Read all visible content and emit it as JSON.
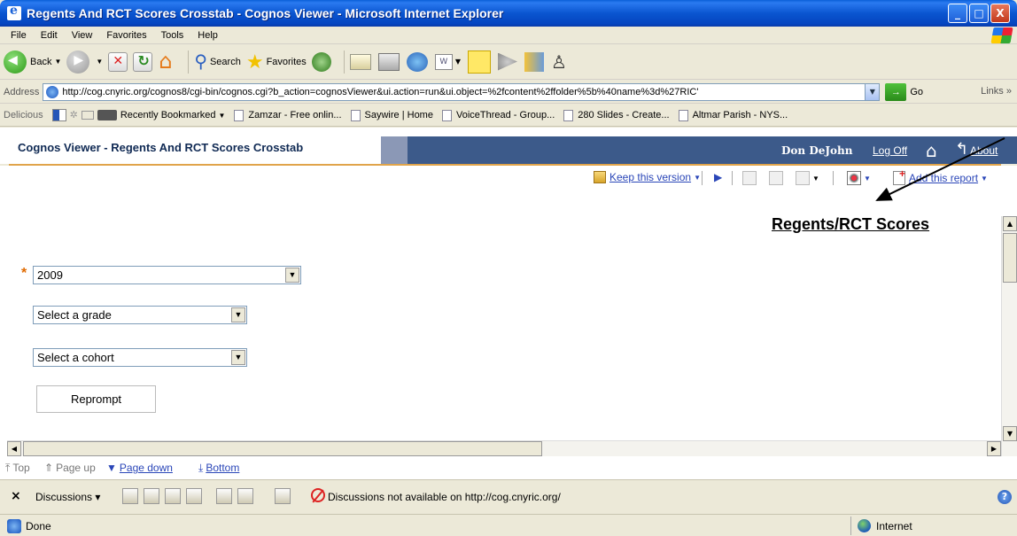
{
  "window": {
    "title": "Regents And RCT Scores Crosstab - Cognos Viewer - Microsoft Internet Explorer",
    "controls": {
      "minimize": "_",
      "maximize": "□",
      "close": "X"
    }
  },
  "menu": {
    "items": [
      "File",
      "Edit",
      "View",
      "Favorites",
      "Tools",
      "Help"
    ]
  },
  "toolbar": {
    "back": "Back",
    "search": "Search",
    "favorites": "Favorites",
    "word_label": "W"
  },
  "address": {
    "label": "Address",
    "url": "http://cog.cnyric.org/cognos8/cgi-bin/cognos.cgi?b_action=cognosViewer&ui.action=run&ui.object=%2fcontent%2ffolder%5b%40name%3d%27RIC'",
    "go": "Go",
    "links": "Links"
  },
  "links_bar": {
    "delicious": "Delicious",
    "recent": "Recently Bookmarked",
    "items": [
      "Zamzar - Free onlin...",
      "Saywire | Home",
      "VoiceThread - Group...",
      "280 Slides - Create...",
      "Altmar Parish - NYS..."
    ]
  },
  "cognos": {
    "title": "Cognos Viewer - Regents And RCT Scores Crosstab",
    "user": "Don DeJohn",
    "logoff": "Log Off",
    "about": "About",
    "keep_version": "Keep this version",
    "add_report": "Add this report"
  },
  "report": {
    "title": "Regents/RCT Scores",
    "required_marker": "*",
    "year_select": "2009",
    "grade_select": "Select a grade",
    "cohort_select": "Select a cohort",
    "reprompt": "Reprompt"
  },
  "page_nav": {
    "top": "Top",
    "page_up": "Page up",
    "page_down": "Page down",
    "bottom": "Bottom"
  },
  "discussions": {
    "close": "×",
    "label": "Discussions",
    "message": "Discussions not available on http://cog.cnyric.org/"
  },
  "status": {
    "text": "Done",
    "zone": "Internet"
  }
}
